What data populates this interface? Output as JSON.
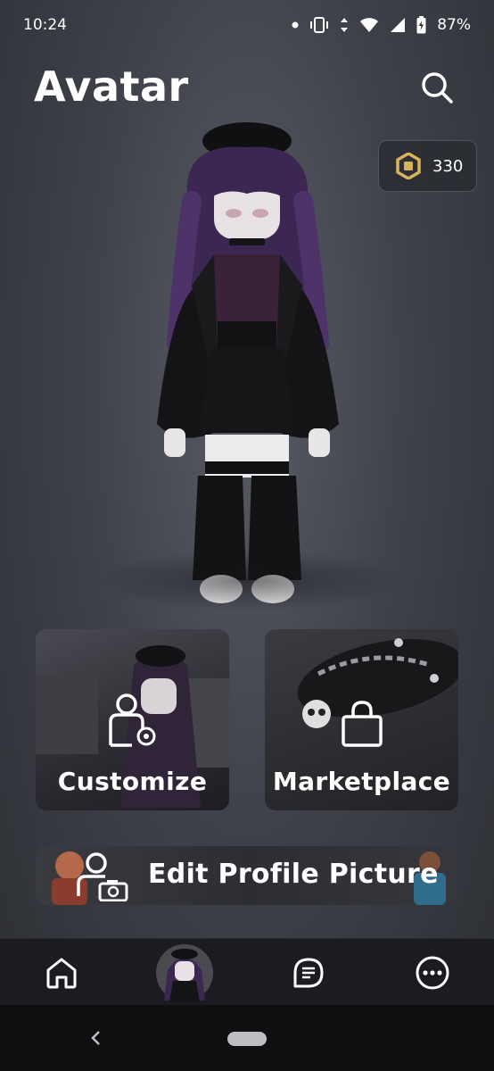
{
  "status_bar": {
    "time": "10:24",
    "battery_percent": "87%",
    "icons": [
      "dot-icon",
      "vibrate-icon",
      "data-arrows-icon",
      "wifi-icon",
      "signal-icon",
      "battery-charging-icon"
    ]
  },
  "header": {
    "title": "Avatar",
    "search_icon": "search-icon"
  },
  "robux": {
    "icon": "robux-icon",
    "balance": "330"
  },
  "tiles": {
    "customize": {
      "label": "Customize",
      "icon": "customize-avatar-icon"
    },
    "marketplace": {
      "label": "Marketplace",
      "icon": "shopping-bag-icon"
    }
  },
  "edit_profile": {
    "label": "Edit Profile Picture",
    "icon": "profile-camera-icon"
  },
  "bottom_nav": {
    "items": [
      {
        "name": "home",
        "icon": "home-icon"
      },
      {
        "name": "avatar",
        "icon": "avatar-thumbnail"
      },
      {
        "name": "chat",
        "icon": "chat-icon"
      },
      {
        "name": "more",
        "icon": "more-icon"
      }
    ]
  },
  "system_nav": {
    "back_icon": "back-chevron-icon",
    "home_pill": "home-pill"
  },
  "colors": {
    "background": "#3f424a",
    "nav_background": "#1b1c20",
    "robux_gold": "#d8b35a",
    "hair_purple": "#4b2f6b"
  }
}
